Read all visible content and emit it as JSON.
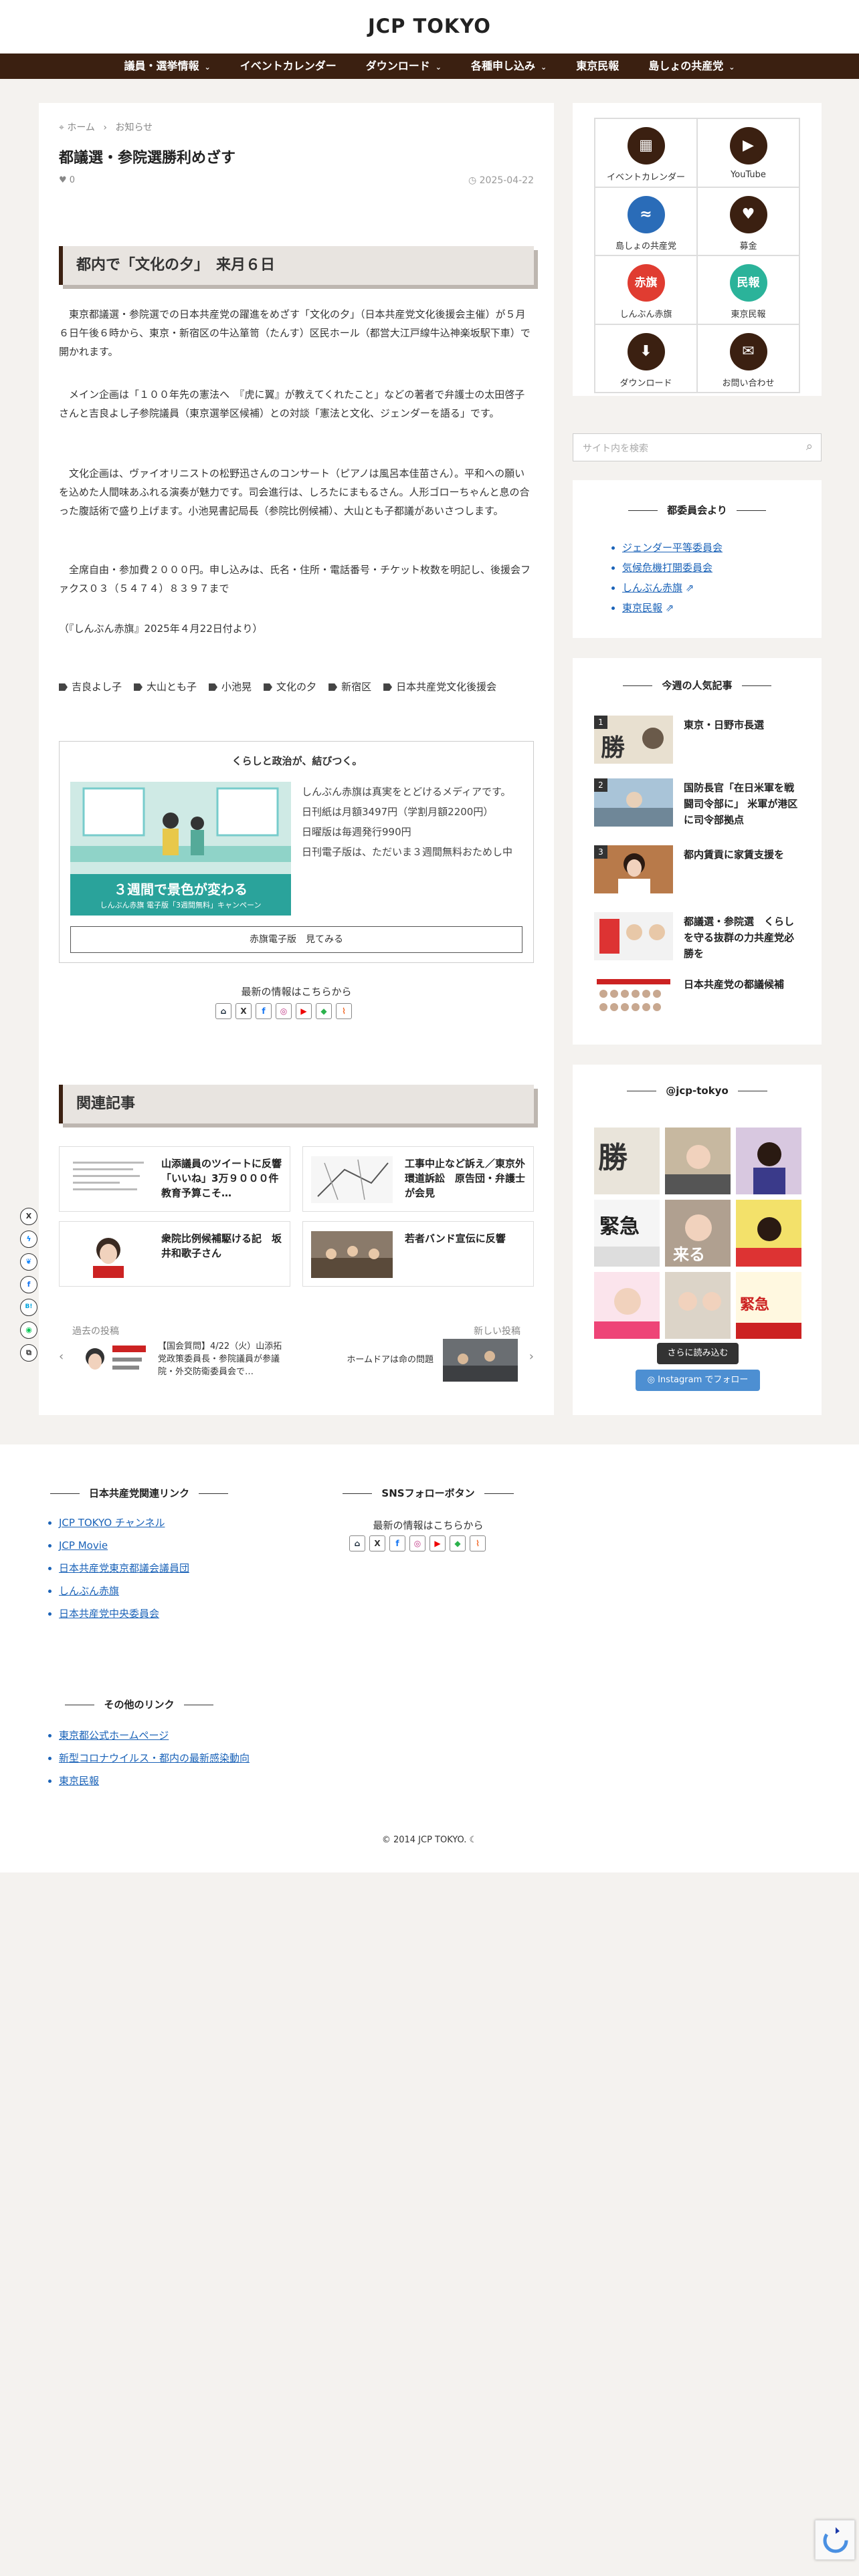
{
  "site": {
    "title": "JCP TOKYO"
  },
  "nav": [
    {
      "label": "議員・選挙情報",
      "chev": "⌄"
    },
    {
      "label": "イベントカレンダー",
      "chev": ""
    },
    {
      "label": "ダウンロード",
      "chev": "⌄"
    },
    {
      "label": "各種申し込み",
      "chev": "⌄"
    },
    {
      "label": "東京民報",
      "chev": ""
    },
    {
      "label": "島しょの共産党",
      "chev": "⌄"
    }
  ],
  "article": {
    "breadcrumb": {
      "home": "ホーム",
      "sep": "›",
      "cat": "お知らせ"
    },
    "title": "都議選・参院選勝利めざす",
    "likes": "0",
    "date": "2025-04-22",
    "heading": "都内で「文化の夕」　来月６日",
    "paras": [
      "　東京都議選・参院選での日本共産党の躍進をめざす「文化の夕」（日本共産党文化後援会主催）が５月６日午後６時から、東京・新宿区の牛込箪笥（たんす）区民ホール（都営大江戸線牛込神楽坂駅下車）で開かれます。",
      "　メイン企画は「１００年先の憲法へ　『虎に翼』が教えてくれたこと」などの著者で弁護士の太田啓子さんと吉良よし子参院議員（東京選挙区候補）との対談「憲法と文化、ジェンダーを語る」です。",
      "　文化企画は、ヴァイオリニストの松野迅さんのコンサート（ピアノは風呂本佳苗さん）。平和への願いを込めた人間味あふれる演奏が魅力です。司会進行は、しろたにまもるさん。人形ゴローちゃんと息の合った腹話術で盛り上げます。小池晃書記局長（参院比例候補）、大山とも子都議があいさつします。",
      "　全席自由・参加費２０００円。申し込みは、氏名・住所・電話番号・チケット枚数を明記し、後援会ファクス０３（５４７４）８３９７まで",
      "（『しんぶん赤旗』2025年４月22日付より）"
    ],
    "tags": [
      "吉良よし子",
      "大山とも子",
      "小池晃",
      "文化の夕",
      "新宿区",
      "日本共産党文化後援会"
    ],
    "ad": {
      "title": "くらしと政治が、結びつく。",
      "img_caption": "３週間で景色が変わる",
      "img_sub": "しんぶん赤旗 電子版「3週間無料」キャンペーン",
      "lines": [
        "しんぶん赤旗は真実をとどけるメディアです。",
        "日刊紙は月額3497円（学割月額2200円）",
        "日曜版は毎週発行990円",
        "日刊電子版は、ただいま３週間無料おためし中"
      ],
      "button": "赤旗電子版　見てみる"
    },
    "sns_label": "最新の情報はこちらから",
    "related_heading": "関連記事",
    "related": [
      "山添議員のツイートに反響「いいね」3万９０００件　教育予算こそ…",
      "工事中止など訴え／東京外環道訴訟　原告団・弁護士が会見",
      "衆院比例候補駆ける記　坂井和歌子さん",
      "若者バンド宣伝に反響"
    ],
    "prev": {
      "label": "過去の投稿",
      "text": "【国会質問】4/22（火）山添拓 党政策委員長・参院議員が参議院・外交防衛委員会で…"
    },
    "next": {
      "label": "新しい投稿",
      "text": "ホームドアは命の問題"
    }
  },
  "sidebar": {
    "icons": [
      {
        "label": "イベントカレンダー",
        "glyph": "▦",
        "color": "#3b2011"
      },
      {
        "label": "YouTube",
        "glyph": "▶",
        "color": "#3b2011"
      },
      {
        "label": "島しょの共産党",
        "glyph": "≈",
        "color": "#2a6cb8"
      },
      {
        "label": "募金",
        "glyph": "♥",
        "color": "#3b2011"
      },
      {
        "label": "しんぶん赤旗",
        "glyph": "赤旗",
        "color": "#e03c31"
      },
      {
        "label": "東京民報",
        "glyph": "民報",
        "color": "#2bb39a"
      },
      {
        "label": "ダウンロード",
        "glyph": "⬇",
        "color": "#3b2011"
      },
      {
        "label": "お問い合わせ",
        "glyph": "✉",
        "color": "#3b2011"
      }
    ],
    "search_placeholder": "サイト内を検索",
    "council": {
      "title": "都委員会より",
      "items": [
        "ジェンダー平等委員会",
        "気候危機打開委員会",
        "しんぶん赤旗",
        "東京民報"
      ]
    },
    "popular": {
      "title": "今週の人気記事",
      "items": [
        "東京・日野市長選",
        "国防長官「在日米軍を戦闘司令部に」 米軍が港区に司令部拠点",
        "都内賃貢に家賃支援を",
        "都議選・参院選　くらしを守る抜群の力共産党必勝を",
        "日本共産党の都議候補"
      ]
    },
    "instagram": {
      "title": "@jcp-tokyo",
      "more": "さらに読み込む",
      "follow": "Instagram でフォロー"
    }
  },
  "footer": {
    "links_title": "日本共産党関連リンク",
    "links": [
      "JCP TOKYO チャンネル",
      "JCP Movie",
      "日本共産党東京都議会議員団",
      "しんぶん赤旗",
      "日本共産党中央委員会"
    ],
    "sns_title": "SNSフォローボタン",
    "sns_label": "最新の情報はこちらから",
    "other_title": "その他のリンク",
    "other": [
      "東京都公式ホームページ",
      "新型コロナウイルス・都内の最新感染動向",
      "東京民報"
    ],
    "copyright": "© 2014 JCP TOKYO."
  }
}
